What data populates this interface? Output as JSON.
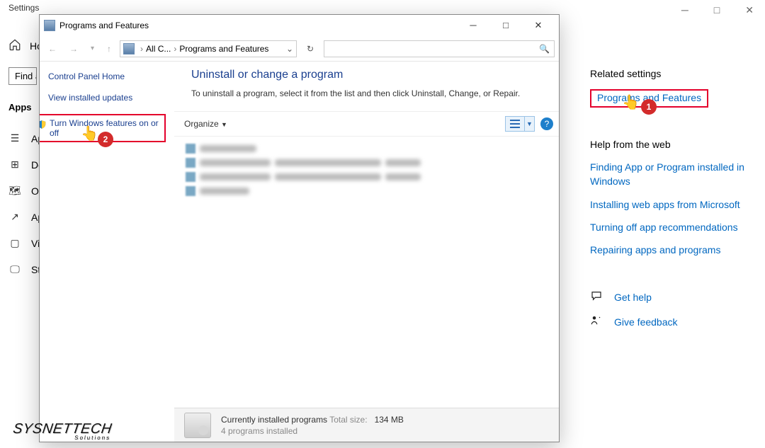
{
  "settings": {
    "title": "Settings",
    "home": "Ho",
    "search_placeholder": "Find a",
    "apps_heading": "Apps",
    "nav": [
      {
        "label": "Ap"
      },
      {
        "label": "De"
      },
      {
        "label": "Of"
      },
      {
        "label": "Ap"
      },
      {
        "label": "Vi"
      },
      {
        "label": "St"
      }
    ],
    "related_heading": "Related settings",
    "programs_features_link": "Programs and Features",
    "help_heading": "Help from the web",
    "help_links": [
      "Finding App or Program installed in Windows",
      "Installing web apps from Microsoft",
      "Turning off app recommendations",
      "Repairing apps and programs"
    ],
    "get_help": "Get help",
    "give_feedback": "Give feedback"
  },
  "dialog": {
    "title": "Programs and Features",
    "breadcrumb": {
      "root": "All C...",
      "leaf": "Programs and Features"
    },
    "sidebar": {
      "home": "Control Panel Home",
      "updates": "View installed updates",
      "features": "Turn Windows features on or off"
    },
    "main": {
      "heading": "Uninstall or change a program",
      "subtext": "To uninstall a program, select it from the list and then click Uninstall, Change, or Repair.",
      "organize": "Organize"
    },
    "status": {
      "line1a": "Currently installed programs",
      "line1b": "Total size:",
      "line1c": "134 MB",
      "line2": "4 programs installed"
    }
  },
  "callouts": {
    "badge1": "1",
    "badge2": "2"
  },
  "watermark": {
    "main": "SYSNETTECH",
    "sub": "Solutions"
  }
}
